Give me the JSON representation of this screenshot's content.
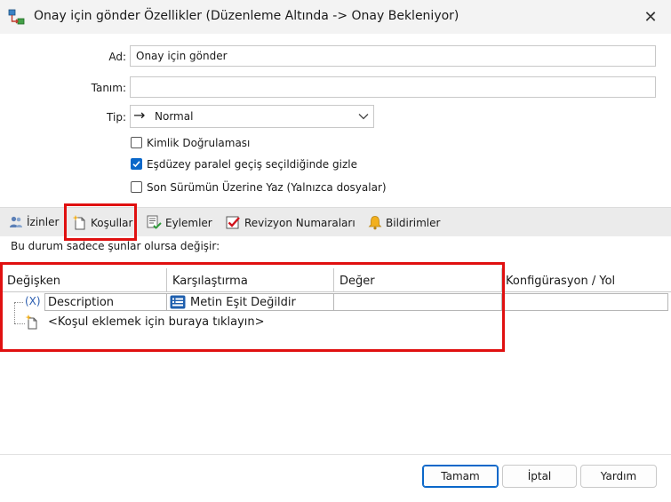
{
  "window": {
    "title": "Onay için gönder Özellikler (Düzenleme Altında -> Onay Bekleniyor)",
    "close_glyph": "✕"
  },
  "form": {
    "name_label": "Ad:",
    "name_value": "Onay için gönder",
    "description_label": "Tanım:",
    "description_value": "",
    "type_label": "Tip:",
    "type_value": "Normal",
    "type_arrow": "→",
    "checkboxes": [
      {
        "label": "Kimlik Doğrulaması",
        "checked": false
      },
      {
        "label": "Eşdüzey paralel geçiş seçildiğinde gizle",
        "checked": true
      },
      {
        "label": "Son Sürümün Üzerine Yaz (Yalnızca dosyalar)",
        "checked": false
      }
    ]
  },
  "tabs": [
    {
      "label": "İzinler",
      "icon": "users-icon"
    },
    {
      "label": "Koşullar",
      "icon": "new-document-icon",
      "active": true
    },
    {
      "label": "Eylemler",
      "icon": "checklist-icon"
    },
    {
      "label": "Revizyon Numaraları",
      "icon": "red-check-icon"
    },
    {
      "label": "Bildirimler",
      "icon": "bell-icon"
    }
  ],
  "conditions": {
    "intro": "Bu durum sadece şunlar olursa değişir:",
    "columns": [
      "Değişken",
      "Karşılaştırma",
      "Değer",
      "Konfigürasyon / Yol"
    ],
    "rows": [
      {
        "variable_symbol": "(X)",
        "variable": "Description",
        "comparison": "Metin Eşit Değildir",
        "value": "",
        "config": ""
      }
    ],
    "add_prompt": "<Koşul eklemek için buraya tıklayın>"
  },
  "buttons": {
    "ok": "Tamam",
    "cancel": "İptal",
    "help": "Yardım"
  },
  "colors": {
    "highlight_red": "#e01010",
    "accent_blue": "#0a67c9"
  }
}
